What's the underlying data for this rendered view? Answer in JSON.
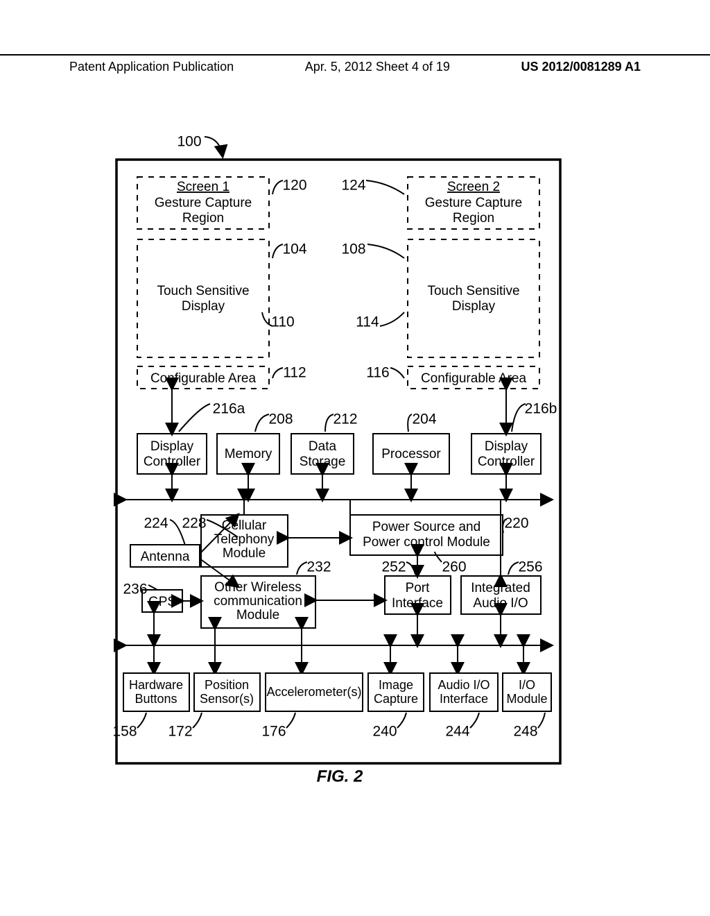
{
  "header": {
    "left": "Patent Application Publication",
    "mid": "Apr. 5, 2012   Sheet 4 of 19",
    "right": "US 2012/0081289 A1"
  },
  "title": "FIG. 2",
  "refs": {
    "r100": "100",
    "r120": "120",
    "r124": "124",
    "r104": "104",
    "r108": "108",
    "r110": "110",
    "r114": "114",
    "r112": "112",
    "r116": "116",
    "r216a": "216a",
    "r216b": "216b",
    "r208": "208",
    "r212": "212",
    "r204": "204",
    "r224": "224",
    "r228": "228",
    "r232": "232",
    "r220": "220",
    "r236": "236",
    "r252": "252",
    "r256": "256",
    "r260": "260",
    "r158": "158",
    "r172": "172",
    "r176": "176",
    "r240": "240",
    "r244": "244",
    "r248": "248"
  },
  "blocks": {
    "screen1": "Screen 1",
    "screen2": "Screen 2",
    "gestureCapture": "Gesture Capture",
    "region": "Region",
    "touchSensitive": "Touch Sensitive",
    "display": "Display",
    "configurable": "Configurable Area",
    "displayController": "Display",
    "controller": "Controller",
    "memory": "Memory",
    "data": "Data",
    "storage": "Storage",
    "processor": "Processor",
    "cellular": "Cellular",
    "telephony": "Telephony",
    "module": "Module",
    "powerSource": "Power Source and",
    "powerControl": "Power control Module",
    "antenna": "Antenna",
    "otherWireless": "Other Wireless",
    "communication": "communication",
    "gps": "GPS",
    "port": "Port",
    "interface": "Interface",
    "integrated": "Integrated",
    "audioIO": "Audio I/O",
    "hardware": "Hardware",
    "buttons": "Buttons",
    "position": "Position",
    "sensors": "Sensor(s)",
    "accel": "Accelerometer(s)",
    "image": "Image",
    "capture": "Capture",
    "io": "I/O"
  }
}
